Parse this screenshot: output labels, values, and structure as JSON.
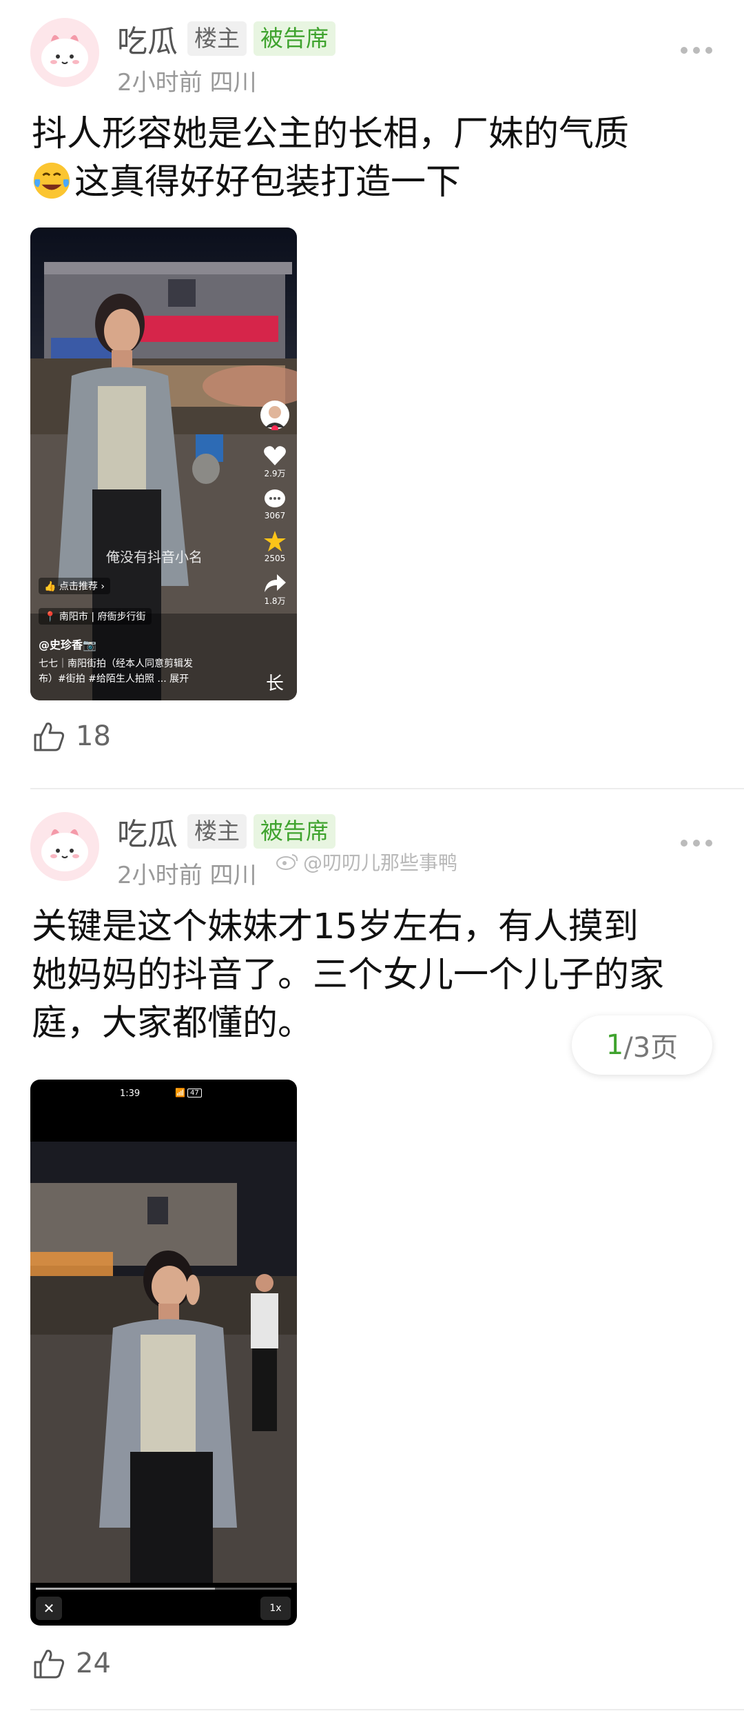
{
  "posts": [
    {
      "author": "吃瓜",
      "tag_owner": "楼主",
      "tag_defendant": "被告席",
      "meta": "2小时前 四川",
      "text_line1": "抖人形容她是公主的长相，厂妹的气质",
      "text_line2": "这真得好好包装打造一下",
      "likes": "18",
      "video": {
        "caption_hint": "俺没有抖音小名",
        "recommend": "点击推荐",
        "location_city": "南阳市",
        "location_spot": "府衙步行街",
        "username": "@史珍香📷",
        "desc1": "七七｜南阳街拍（经本人同意剪辑发",
        "desc2": "布）#街拍 #给陌生人拍照 ... 展开",
        "likes": "2.9万",
        "comments": "3067",
        "favorites": "2505",
        "shares": "1.8万",
        "corner_text": "长"
      }
    },
    {
      "author": "吃瓜",
      "tag_owner": "楼主",
      "tag_defendant": "被告席",
      "meta": "2小时前 四川",
      "watermark": "@叨叨儿那些事鸭",
      "text_line1": "关键是这个妹妹才15岁左右，有人摸到",
      "text_line2": "她妈妈的抖音了。三个女儿一个儿子的家",
      "text_line3": "庭，大家都懂的。",
      "page_current": "1",
      "page_total": "/3页",
      "likes": "24",
      "video": {
        "status_time": "1:39",
        "status_battery": "47",
        "speed": "1x"
      }
    }
  ],
  "colors": {
    "accent_green": "#3fa32e",
    "muted_gray": "#999999"
  }
}
